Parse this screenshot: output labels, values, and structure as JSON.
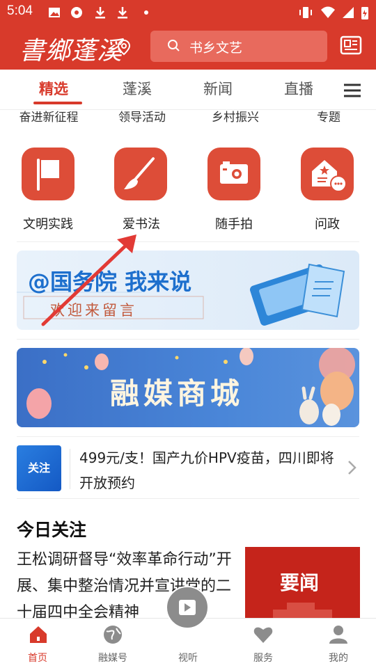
{
  "status": {
    "time": "5:04"
  },
  "header": {
    "logo_text": "書鄉蓬溪",
    "search_placeholder": "书乡文艺"
  },
  "tabs": [
    {
      "label": "精选",
      "active": true
    },
    {
      "label": "蓬溪"
    },
    {
      "label": "新闻"
    },
    {
      "label": "直播"
    }
  ],
  "categories": [
    "奋进新征程",
    "领导活动",
    "乡村振兴",
    "专题"
  ],
  "grid": [
    {
      "label": "文明实践",
      "icon": "flag-icon"
    },
    {
      "label": "爱书法",
      "icon": "brush-icon"
    },
    {
      "label": "随手拍",
      "icon": "camera-icon"
    },
    {
      "label": "问政",
      "icon": "house-chat-icon"
    }
  ],
  "banner1": {
    "title": "@国务院 我来说",
    "subtitle": "欢迎来留言"
  },
  "banner2": {
    "title": "融媒商城"
  },
  "ticker": {
    "badge": "关注",
    "text": "499元/支！国产九价HPV疫苗，四川即将开放预约"
  },
  "section": {
    "title": "今日关注"
  },
  "article": {
    "text": "王松调研督导“效率革命行动”开展、集中整治情况并宣讲党的二十届四中全会精神",
    "thumb_text": "要闻"
  },
  "bottom_nav": [
    {
      "label": "首页",
      "active": true
    },
    {
      "label": "融媒号"
    },
    {
      "label": "视听"
    },
    {
      "label": "服务"
    },
    {
      "label": "我的"
    }
  ],
  "colors": {
    "brand": "#d83a2b",
    "icon_bg": "#dd4d38",
    "badge_blue": "#1f6bd8"
  }
}
